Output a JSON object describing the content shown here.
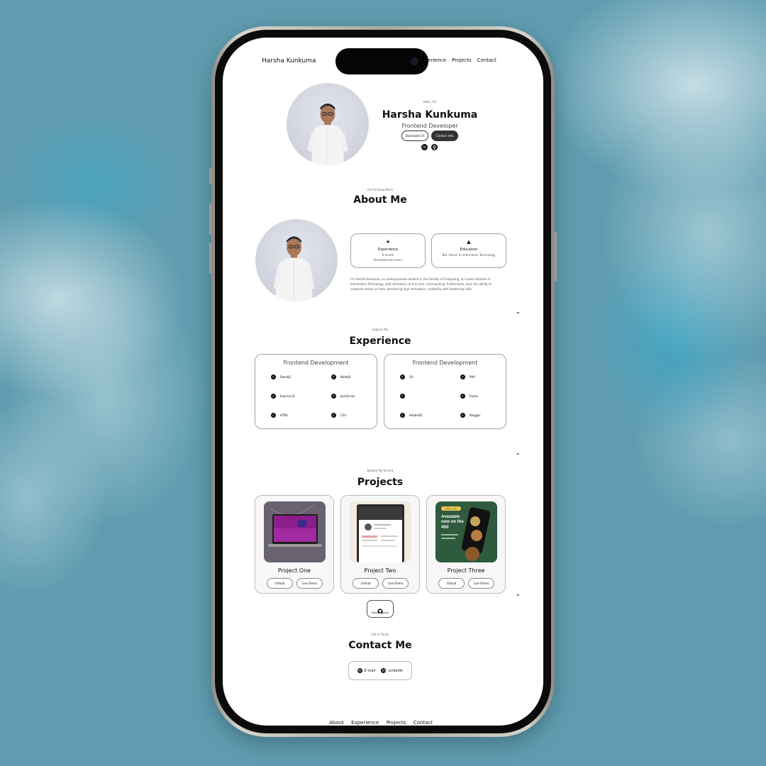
{
  "nav": {
    "brand": "Harsha Kunkuma",
    "links": [
      "Experience",
      "Projects",
      "Contact"
    ]
  },
  "hero": {
    "hello": "Hello, I'm",
    "name": "Harsha Kunkuma",
    "role": "Frontend Developer",
    "download_cv": "Download CV",
    "contact_info": "Contact Info",
    "socials": [
      "linkedin-icon",
      "github-icon"
    ]
  },
  "about": {
    "subtitle": "Get To Know More",
    "title": "About Me",
    "cards": [
      {
        "icon": "award-icon",
        "title": "Experience",
        "lines": [
          "6 month",
          "Development Intern"
        ]
      },
      {
        "icon": "graduation-icon",
        "title": "Education",
        "lines": [
          "BSc (Hons) In Information Technology"
        ]
      }
    ],
    "text": "I'm Harsha Kunkuma, an undergraduate student in the Faculty of Computing, Sri Lanka Institute of Information Technology, with dedication at any time, hard-working, furthermore, have the ability to complete duties on time, possessing high motivation, credibility with leadership skills."
  },
  "experience": {
    "subtitle": "Explore My",
    "title": "Experience",
    "groups": [
      {
        "title": "Frontend Development",
        "skills": [
          "ReactJS",
          "NodeJS",
          "Express.JS",
          "JavaScript",
          "HTML",
          "CSS"
        ]
      },
      {
        "title": "Frontend Development",
        "skills": [
          "Git",
          "PHP",
          "",
          "Figma",
          "AdobeXD",
          "Blogger"
        ]
      }
    ]
  },
  "projects": {
    "subtitle": "Browse My Recent",
    "title": "Projects",
    "items": [
      {
        "name": "Project One",
        "github": "Github",
        "demo": "Live Demo"
      },
      {
        "name": "Project Two",
        "github": "Github",
        "demo": "Live Demo"
      },
      {
        "name": "Project Three",
        "github": "Github",
        "demo": "Live Demo"
      }
    ],
    "more": "More Projects",
    "project_three_badge": "Order now",
    "project_three_heading": "Available now on the app"
  },
  "contact": {
    "subtitle": "Get in Touch",
    "title": "Contact Me",
    "email": "E-mail",
    "linkedin": "LinkedIn"
  },
  "footer": {
    "links": [
      "About",
      "Experience",
      "Projects",
      "Contact"
    ]
  },
  "colors": {
    "background": "#5f9cb0",
    "accent": "#333333",
    "screen": "#ffffff"
  }
}
